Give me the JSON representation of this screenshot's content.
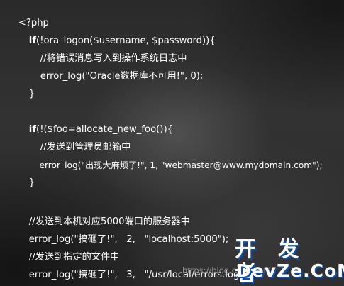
{
  "code": {
    "lines": [
      {
        "text": "<?php",
        "indent": 0
      },
      {
        "keyword": "if",
        "text": "(!ora_logon($username, $password)){",
        "indent": 1
      },
      {
        "text": "//将错误消息写入到操作系统日志中",
        "indent": 2
      },
      {
        "text": "error_log(\"Oracle数据库不可用!\", 0);",
        "indent": 2
      },
      {
        "text": "}",
        "indent": 1
      },
      {
        "text": "",
        "indent": 0
      },
      {
        "keyword": "if",
        "text": "(!($foo=allocate_new_foo()){",
        "indent": 1
      },
      {
        "text": "//发送到管理员邮箱中",
        "indent": 2
      },
      {
        "text": "error_log(\"出现大麻烦了!\", 1, \"webmaster@www.mydomain.com\");",
        "indent": 2
      },
      {
        "text": "}",
        "indent": 1
      },
      {
        "text": "",
        "indent": 0
      },
      {
        "text": "//发送到本机对应5000端口的服务器中",
        "indent": 1
      },
      {
        "text": "error_log(\"搞砸了!\",   2,   \"localhost:5000\");",
        "indent": 1
      },
      {
        "text": "//发送到指定的文件中",
        "indent": 1
      },
      {
        "text": "error_log(\"搞砸了!\",   3,   \"/usr/local/errors.log\");",
        "indent": 1
      },
      {
        "text": "?>",
        "indent": 0
      }
    ]
  },
  "watermark": {
    "url": "https://blog.csdn.net/",
    "logo_cn": "开 发 者",
    "logo_en": "DevZe.CoM"
  }
}
